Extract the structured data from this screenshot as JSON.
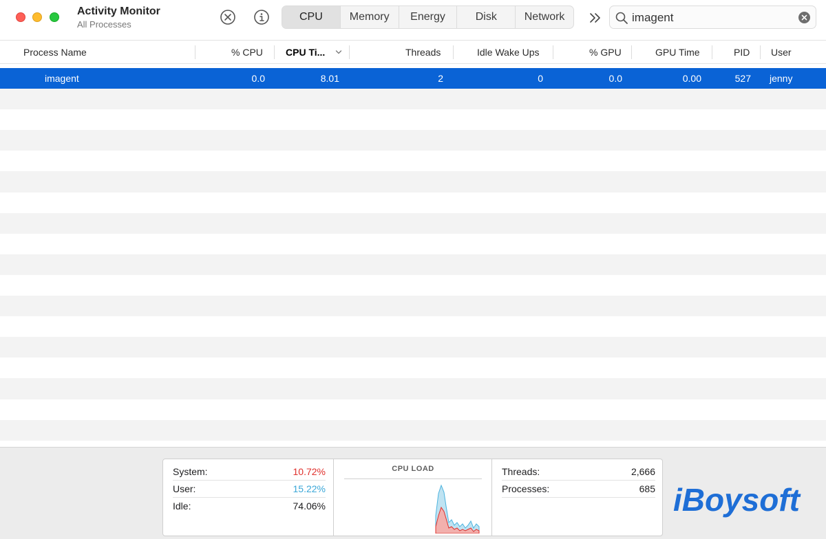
{
  "window": {
    "title": "Activity Monitor",
    "subtitle": "All Processes"
  },
  "toolbar": {
    "stop_icon": "x-circle-icon",
    "info_icon": "info-icon",
    "tabs": [
      {
        "label": "CPU",
        "active": true
      },
      {
        "label": "Memory",
        "active": false
      },
      {
        "label": "Energy",
        "active": false
      },
      {
        "label": "Disk",
        "active": false
      },
      {
        "label": "Network",
        "active": false
      }
    ],
    "more_icon": "double-chevron-right-icon"
  },
  "search": {
    "value": "imagent",
    "placeholder": "Search"
  },
  "table": {
    "columns": [
      "Process Name",
      "% CPU",
      "CPU Ti...",
      "Threads",
      "Idle Wake Ups",
      "% GPU",
      "GPU Time",
      "PID",
      "User"
    ],
    "sorted_column": "CPU Ti...",
    "rows": [
      {
        "process_name": "imagent",
        "cpu_percent": "0.0",
        "cpu_time": "8.01",
        "threads": "2",
        "idle_wake_ups": "0",
        "gpu_percent": "0.0",
        "gpu_time": "0.00",
        "pid": "527",
        "user": "jenny",
        "selected": true
      }
    ]
  },
  "footer": {
    "system_label": "System:",
    "system_value": "10.72%",
    "user_label": "User:",
    "user_value": "15.22%",
    "idle_label": "Idle:",
    "idle_value": "74.06%",
    "cpu_load_title": "CPU LOAD",
    "threads_label": "Threads:",
    "threads_value": "2,666",
    "processes_label": "Processes:",
    "processes_value": "685"
  },
  "colors": {
    "selection": "#0a63d6",
    "system": "#e0302c",
    "user": "#3ba7d8",
    "logo": "#1e6ed6"
  },
  "watermark": {
    "text": "iBoysoft"
  }
}
